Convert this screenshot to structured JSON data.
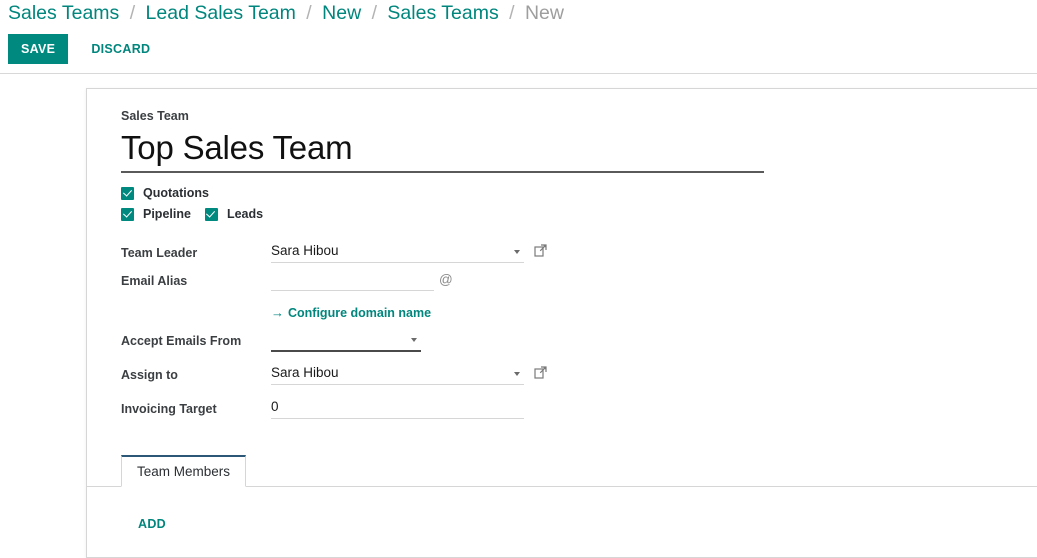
{
  "breadcrumb": {
    "items": [
      {
        "label": "Sales Teams",
        "active": false
      },
      {
        "label": "Lead Sales Team",
        "active": false
      },
      {
        "label": "New",
        "active": false
      },
      {
        "label": "Sales Teams",
        "active": false
      },
      {
        "label": "New",
        "active": true
      }
    ],
    "separator": "/"
  },
  "actions": {
    "save_label": "SAVE",
    "discard_label": "DISCARD"
  },
  "form": {
    "title_label": "Sales Team",
    "title_value": "Top Sales Team",
    "checkboxes": [
      {
        "label": "Quotations",
        "checked": true
      },
      {
        "label": "Pipeline",
        "checked": true
      },
      {
        "label": "Leads",
        "checked": true
      }
    ],
    "fields": {
      "team_leader": {
        "label": "Team Leader",
        "value": "Sara Hibou"
      },
      "email_alias": {
        "label": "Email Alias",
        "value": "",
        "suffix": "@"
      },
      "configure_domain": {
        "label": "Configure domain name",
        "arrow": "→"
      },
      "accept_emails_from": {
        "label": "Accept Emails From",
        "value": ""
      },
      "assign_to": {
        "label": "Assign to",
        "value": "Sara Hibou"
      },
      "invoicing_target": {
        "label": "Invoicing Target",
        "value": "0"
      }
    }
  },
  "notebook": {
    "tabs": [
      {
        "label": "Team Members",
        "active": true
      }
    ],
    "add_label": "ADD"
  },
  "colors": {
    "accent": "#00897f",
    "link": "#00867d",
    "tab_active_border": "#2c5777",
    "muted": "#9e9e9e"
  }
}
